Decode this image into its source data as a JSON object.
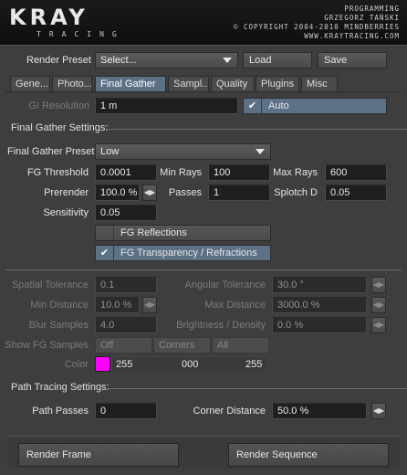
{
  "header": {
    "logo": "KRAY",
    "logo_sub": "TRACING",
    "programming": "PROGRAMMING",
    "author": "GRZEGORZ TAŃSKI",
    "copyright": "© COPYRIGHT 2004-2010 MINDBERRIES",
    "website": "WWW.KRAYTRACING.COM"
  },
  "preset": {
    "label": "Render Preset",
    "value": "Select...",
    "load": "Load",
    "save": "Save"
  },
  "tabs": [
    "Gene...",
    "Photo...",
    "Final Gather",
    "Sampl...",
    "Quality",
    "Plugins",
    "Misc"
  ],
  "active_tab": "Final Gather",
  "gi": {
    "label": "GI Resolution",
    "value": "1 m",
    "auto_label": "Auto",
    "auto_checked": true
  },
  "fg_section": {
    "title": "Final Gather Settings:",
    "preset_label": "Final Gather Preset",
    "preset_value": "Low",
    "fg_threshold_label": "FG Threshold",
    "fg_threshold": "0.0001",
    "min_rays_label": "Min Rays",
    "min_rays": "100",
    "max_rays_label": "Max Rays",
    "max_rays": "600",
    "prerender_label": "Prerender",
    "prerender": "100.0 %",
    "passes_label": "Passes",
    "passes": "1",
    "splotch_label": "Splotch D",
    "splotch": "0.05",
    "sensitivity_label": "Sensitivity",
    "sensitivity": "0.05",
    "reflections_label": "FG Reflections",
    "reflections_checked": false,
    "transparency_label": "FG Transparency / Refractions",
    "transparency_checked": true
  },
  "cache": {
    "spatial_label": "Spatial Tolerance",
    "spatial": "0.1",
    "angular_label": "Angular Tolerance",
    "angular": "30.0 °",
    "min_dist_label": "Min Distance",
    "min_dist": "10.0 %",
    "max_dist_label": "Max Distance",
    "max_dist": "3000.0 %",
    "blur_label": "Blur Samples",
    "blur": "4.0",
    "brightness_label": "Brightness / Density",
    "brightness": "0.0 %",
    "show_label": "Show FG Samples",
    "show_options": [
      "Off",
      "Corners",
      "All"
    ],
    "color_label": "Color",
    "color_swatch": "#ff00ff",
    "color_r": "255",
    "color_g": "000",
    "color_b": "255"
  },
  "path": {
    "title": "Path Tracing Settings:",
    "passes_label": "Path Passes",
    "passes": "0",
    "corner_label": "Corner Distance",
    "corner": "50.0 %"
  },
  "bottom": {
    "render_frame": "Render Frame",
    "render_sequence": "Render Sequence"
  }
}
